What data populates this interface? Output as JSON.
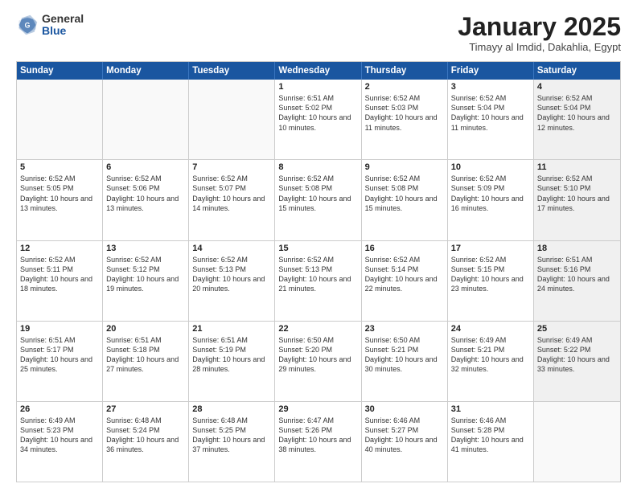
{
  "logo": {
    "general": "General",
    "blue": "Blue"
  },
  "title": "January 2025",
  "location": "Timayy al Imdid, Dakahlia, Egypt",
  "header_days": [
    "Sunday",
    "Monday",
    "Tuesday",
    "Wednesday",
    "Thursday",
    "Friday",
    "Saturday"
  ],
  "weeks": [
    [
      {
        "day": "",
        "sunrise": "",
        "sunset": "",
        "daylight": "",
        "shaded": false,
        "empty": true
      },
      {
        "day": "",
        "sunrise": "",
        "sunset": "",
        "daylight": "",
        "shaded": false,
        "empty": true
      },
      {
        "day": "",
        "sunrise": "",
        "sunset": "",
        "daylight": "",
        "shaded": false,
        "empty": true
      },
      {
        "day": "1",
        "sunrise": "Sunrise: 6:51 AM",
        "sunset": "Sunset: 5:02 PM",
        "daylight": "Daylight: 10 hours and 10 minutes.",
        "shaded": false,
        "empty": false
      },
      {
        "day": "2",
        "sunrise": "Sunrise: 6:52 AM",
        "sunset": "Sunset: 5:03 PM",
        "daylight": "Daylight: 10 hours and 11 minutes.",
        "shaded": false,
        "empty": false
      },
      {
        "day": "3",
        "sunrise": "Sunrise: 6:52 AM",
        "sunset": "Sunset: 5:04 PM",
        "daylight": "Daylight: 10 hours and 11 minutes.",
        "shaded": false,
        "empty": false
      },
      {
        "day": "4",
        "sunrise": "Sunrise: 6:52 AM",
        "sunset": "Sunset: 5:04 PM",
        "daylight": "Daylight: 10 hours and 12 minutes.",
        "shaded": true,
        "empty": false
      }
    ],
    [
      {
        "day": "5",
        "sunrise": "Sunrise: 6:52 AM",
        "sunset": "Sunset: 5:05 PM",
        "daylight": "Daylight: 10 hours and 13 minutes.",
        "shaded": false,
        "empty": false
      },
      {
        "day": "6",
        "sunrise": "Sunrise: 6:52 AM",
        "sunset": "Sunset: 5:06 PM",
        "daylight": "Daylight: 10 hours and 13 minutes.",
        "shaded": false,
        "empty": false
      },
      {
        "day": "7",
        "sunrise": "Sunrise: 6:52 AM",
        "sunset": "Sunset: 5:07 PM",
        "daylight": "Daylight: 10 hours and 14 minutes.",
        "shaded": false,
        "empty": false
      },
      {
        "day": "8",
        "sunrise": "Sunrise: 6:52 AM",
        "sunset": "Sunset: 5:08 PM",
        "daylight": "Daylight: 10 hours and 15 minutes.",
        "shaded": false,
        "empty": false
      },
      {
        "day": "9",
        "sunrise": "Sunrise: 6:52 AM",
        "sunset": "Sunset: 5:08 PM",
        "daylight": "Daylight: 10 hours and 15 minutes.",
        "shaded": false,
        "empty": false
      },
      {
        "day": "10",
        "sunrise": "Sunrise: 6:52 AM",
        "sunset": "Sunset: 5:09 PM",
        "daylight": "Daylight: 10 hours and 16 minutes.",
        "shaded": false,
        "empty": false
      },
      {
        "day": "11",
        "sunrise": "Sunrise: 6:52 AM",
        "sunset": "Sunset: 5:10 PM",
        "daylight": "Daylight: 10 hours and 17 minutes.",
        "shaded": true,
        "empty": false
      }
    ],
    [
      {
        "day": "12",
        "sunrise": "Sunrise: 6:52 AM",
        "sunset": "Sunset: 5:11 PM",
        "daylight": "Daylight: 10 hours and 18 minutes.",
        "shaded": false,
        "empty": false
      },
      {
        "day": "13",
        "sunrise": "Sunrise: 6:52 AM",
        "sunset": "Sunset: 5:12 PM",
        "daylight": "Daylight: 10 hours and 19 minutes.",
        "shaded": false,
        "empty": false
      },
      {
        "day": "14",
        "sunrise": "Sunrise: 6:52 AM",
        "sunset": "Sunset: 5:13 PM",
        "daylight": "Daylight: 10 hours and 20 minutes.",
        "shaded": false,
        "empty": false
      },
      {
        "day": "15",
        "sunrise": "Sunrise: 6:52 AM",
        "sunset": "Sunset: 5:13 PM",
        "daylight": "Daylight: 10 hours and 21 minutes.",
        "shaded": false,
        "empty": false
      },
      {
        "day": "16",
        "sunrise": "Sunrise: 6:52 AM",
        "sunset": "Sunset: 5:14 PM",
        "daylight": "Daylight: 10 hours and 22 minutes.",
        "shaded": false,
        "empty": false
      },
      {
        "day": "17",
        "sunrise": "Sunrise: 6:52 AM",
        "sunset": "Sunset: 5:15 PM",
        "daylight": "Daylight: 10 hours and 23 minutes.",
        "shaded": false,
        "empty": false
      },
      {
        "day": "18",
        "sunrise": "Sunrise: 6:51 AM",
        "sunset": "Sunset: 5:16 PM",
        "daylight": "Daylight: 10 hours and 24 minutes.",
        "shaded": true,
        "empty": false
      }
    ],
    [
      {
        "day": "19",
        "sunrise": "Sunrise: 6:51 AM",
        "sunset": "Sunset: 5:17 PM",
        "daylight": "Daylight: 10 hours and 25 minutes.",
        "shaded": false,
        "empty": false
      },
      {
        "day": "20",
        "sunrise": "Sunrise: 6:51 AM",
        "sunset": "Sunset: 5:18 PM",
        "daylight": "Daylight: 10 hours and 27 minutes.",
        "shaded": false,
        "empty": false
      },
      {
        "day": "21",
        "sunrise": "Sunrise: 6:51 AM",
        "sunset": "Sunset: 5:19 PM",
        "daylight": "Daylight: 10 hours and 28 minutes.",
        "shaded": false,
        "empty": false
      },
      {
        "day": "22",
        "sunrise": "Sunrise: 6:50 AM",
        "sunset": "Sunset: 5:20 PM",
        "daylight": "Daylight: 10 hours and 29 minutes.",
        "shaded": false,
        "empty": false
      },
      {
        "day": "23",
        "sunrise": "Sunrise: 6:50 AM",
        "sunset": "Sunset: 5:21 PM",
        "daylight": "Daylight: 10 hours and 30 minutes.",
        "shaded": false,
        "empty": false
      },
      {
        "day": "24",
        "sunrise": "Sunrise: 6:49 AM",
        "sunset": "Sunset: 5:21 PM",
        "daylight": "Daylight: 10 hours and 32 minutes.",
        "shaded": false,
        "empty": false
      },
      {
        "day": "25",
        "sunrise": "Sunrise: 6:49 AM",
        "sunset": "Sunset: 5:22 PM",
        "daylight": "Daylight: 10 hours and 33 minutes.",
        "shaded": true,
        "empty": false
      }
    ],
    [
      {
        "day": "26",
        "sunrise": "Sunrise: 6:49 AM",
        "sunset": "Sunset: 5:23 PM",
        "daylight": "Daylight: 10 hours and 34 minutes.",
        "shaded": false,
        "empty": false
      },
      {
        "day": "27",
        "sunrise": "Sunrise: 6:48 AM",
        "sunset": "Sunset: 5:24 PM",
        "daylight": "Daylight: 10 hours and 36 minutes.",
        "shaded": false,
        "empty": false
      },
      {
        "day": "28",
        "sunrise": "Sunrise: 6:48 AM",
        "sunset": "Sunset: 5:25 PM",
        "daylight": "Daylight: 10 hours and 37 minutes.",
        "shaded": false,
        "empty": false
      },
      {
        "day": "29",
        "sunrise": "Sunrise: 6:47 AM",
        "sunset": "Sunset: 5:26 PM",
        "daylight": "Daylight: 10 hours and 38 minutes.",
        "shaded": false,
        "empty": false
      },
      {
        "day": "30",
        "sunrise": "Sunrise: 6:46 AM",
        "sunset": "Sunset: 5:27 PM",
        "daylight": "Daylight: 10 hours and 40 minutes.",
        "shaded": false,
        "empty": false
      },
      {
        "day": "31",
        "sunrise": "Sunrise: 6:46 AM",
        "sunset": "Sunset: 5:28 PM",
        "daylight": "Daylight: 10 hours and 41 minutes.",
        "shaded": false,
        "empty": false
      },
      {
        "day": "",
        "sunrise": "",
        "sunset": "",
        "daylight": "",
        "shaded": true,
        "empty": true
      }
    ]
  ]
}
